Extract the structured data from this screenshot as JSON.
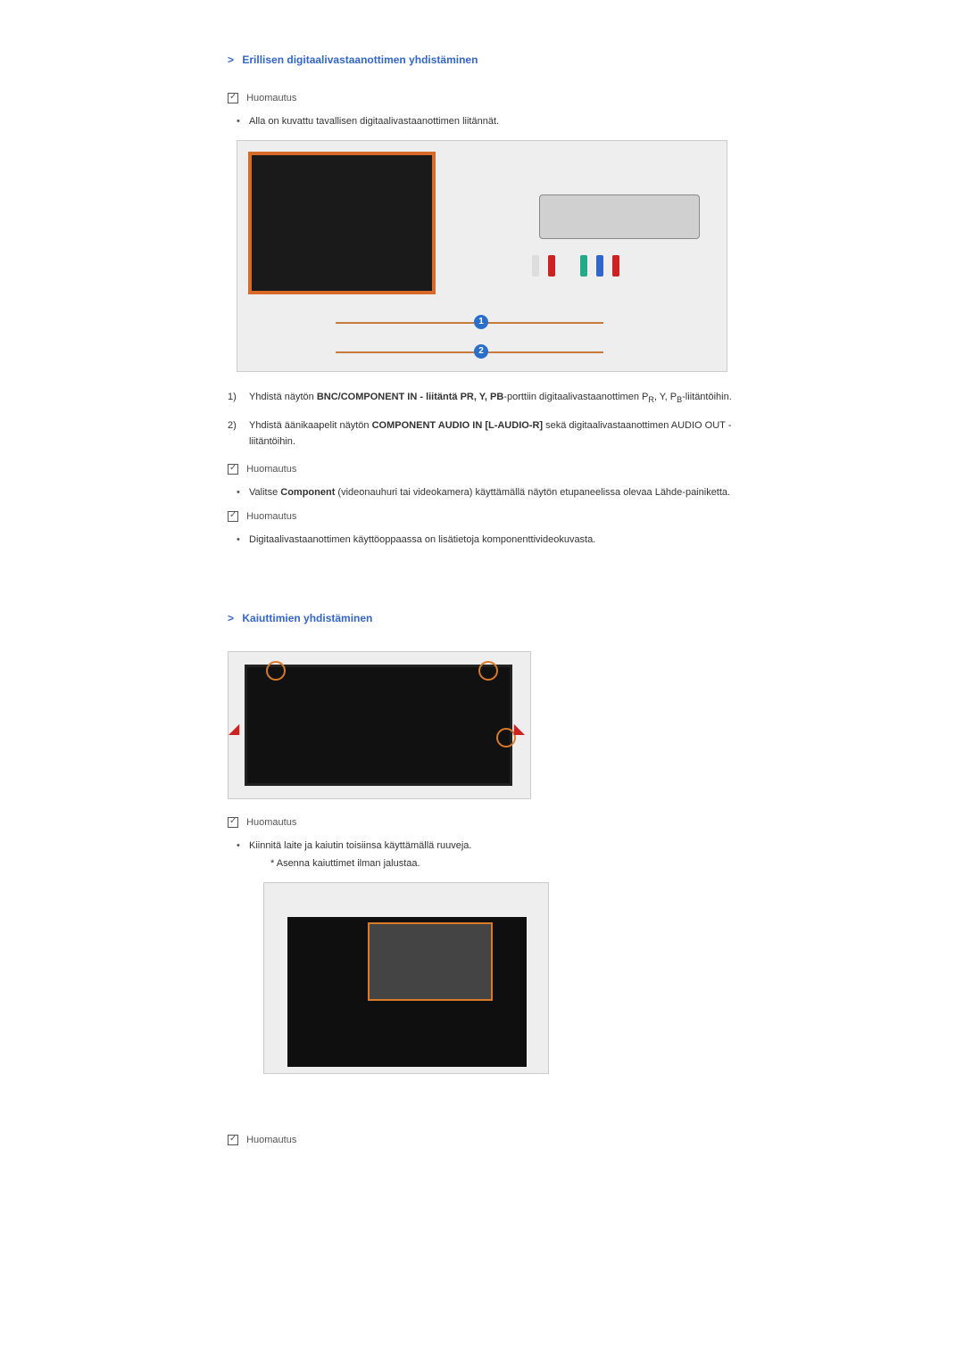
{
  "section1": {
    "title": "Erillisen digitaalivastaanottimen yhdistäminen",
    "note1_label": "Huomautus",
    "note1_bullet": "Alla on kuvattu tavallisen digitaalivastaanottimen liitännät.",
    "step1_num": "1)",
    "step1_pre": "Yhdistä näytön ",
    "step1_bold": "BNC/COMPONENT IN - liitäntä P",
    "step1_r": "R",
    "step1_mid": ", Y, P",
    "step1_b": "B",
    "step1_post": "-porttiin digitaalivastaanottimen P",
    "step1_r2": "R",
    "step1_post2": ", Y, P",
    "step1_b2": "B",
    "step1_end": "-liitäntöihin.",
    "step2_num": "2)",
    "step2_pre": "Yhdistä äänikaapelit näytön ",
    "step2_bold": "COMPONENT AUDIO IN [L-AUDIO-R]",
    "step2_post": " sekä digitaalivastaanottimen AUDIO OUT -liitäntöihin.",
    "note2_label": "Huomautus",
    "note2_pre": "Valitse ",
    "note2_bold": "Component",
    "note2_post": " (videonauhuri tai videokamera) käyttämällä näytön etupaneelissa olevaa Lähde-painiketta.",
    "note3_label": "Huomautus",
    "note3_bullet": "Digitaalivastaanottimen käyttöoppaassa on lisätietoja komponenttivideokuvasta."
  },
  "section2": {
    "title": "Kaiuttimien yhdistäminen",
    "note1_label": "Huomautus",
    "note1_bullet": "Kiinnitä laite ja kaiutin toisiinsa käyttämällä ruuveja.",
    "note1_sub": "* Asenna kaiuttimet ilman jalustaa.",
    "note2_label": "Huomautus"
  },
  "circles": {
    "c1": "1",
    "c2": "2"
  }
}
